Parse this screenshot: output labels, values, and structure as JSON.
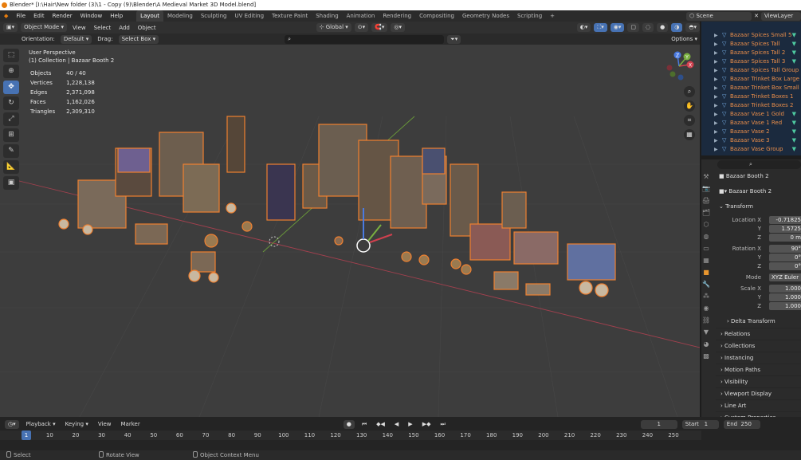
{
  "title": "Blender* [I:\\Hair\\New folder (3)\\1 - Copy (9)\\Blender\\A Medieval Market 3D Model.blend]",
  "menu": [
    "File",
    "Edit",
    "Render",
    "Window",
    "Help"
  ],
  "workspaces": [
    "Layout",
    "Modeling",
    "Sculpting",
    "UV Editing",
    "Texture Paint",
    "Shading",
    "Animation",
    "Rendering",
    "Compositing",
    "Geometry Nodes",
    "Scripting",
    "+"
  ],
  "active_workspace": "Layout",
  "scene": "Scene",
  "view_layer": "ViewLayer",
  "viewport_header": {
    "mode": "Object Mode",
    "menus": [
      "View",
      "Select",
      "Add",
      "Object"
    ],
    "transform": "Global",
    "options": "Options"
  },
  "tool_settings": {
    "orientation_label": "Orientation:",
    "orientation": "Default",
    "drag_label": "Drag:",
    "drag": "Select Box"
  },
  "overlay_text": {
    "view": "User Perspective",
    "collection": "(1) Collection | Bazaar Booth 2"
  },
  "stats": [
    {
      "label": "Objects",
      "value": "40 / 40"
    },
    {
      "label": "Vertices",
      "value": "1,228,138"
    },
    {
      "label": "Edges",
      "value": "2,371,098"
    },
    {
      "label": "Faces",
      "value": "1,162,026"
    },
    {
      "label": "Triangles",
      "value": "2,309,310"
    }
  ],
  "gizmo": {
    "x": "X",
    "y": "Y",
    "z": "Z"
  },
  "outliner": [
    "Bazaar Spices Small 5",
    "Bazaar Spices Tall",
    "Bazaar Spices Tall 2",
    "Bazaar Spices Tall 3",
    "Bazaar Spices Tall Group",
    "Bazaar Trinket Box Large",
    "Bazaar Trinket Box Small",
    "Bazaar Trinket Boxes 1",
    "Bazaar Trinket Boxes 2",
    "Bazaar Vase 1 Gold",
    "Bazaar Vase 1 Red",
    "Bazaar Vase 2",
    "Bazaar Vase 3",
    "Bazaar Vase Group"
  ],
  "properties": {
    "object_name": "Bazaar Booth 2",
    "object_name_field": "Bazaar Booth 2",
    "transform_title": "Transform",
    "location_label": "Location X",
    "loc_x": "-0.71825",
    "loc_y": "1.5725",
    "loc_z": "0 m",
    "rotation_label": "Rotation X",
    "rot_x": "90°",
    "rot_y": "0°",
    "rot_z": "0°",
    "mode_label": "Mode",
    "mode": "XYZ Euler",
    "scale_label": "Scale X",
    "scale_x": "1.000",
    "scale_y": "1.000",
    "scale_z": "1.000",
    "axis_y": "Y",
    "axis_z": "Z",
    "delta": "Delta Transform",
    "panels": [
      "Relations",
      "Collections",
      "Instancing",
      "Motion Paths",
      "Visibility",
      "Viewport Display",
      "Line Art",
      "Custom Properties"
    ]
  },
  "timeline": {
    "menus": [
      "Playback",
      "Keying",
      "View",
      "Marker"
    ],
    "current_frame": "1",
    "start_label": "Start",
    "start": "1",
    "end_label": "End",
    "end": "250",
    "ticks": [
      "1",
      "10",
      "20",
      "30",
      "40",
      "50",
      "60",
      "70",
      "80",
      "90",
      "100",
      "110",
      "120",
      "130",
      "140",
      "150",
      "160",
      "170",
      "180",
      "190",
      "200",
      "210",
      "220",
      "230",
      "240",
      "250"
    ]
  },
  "status": {
    "select": "Select",
    "rotate": "Rotate View",
    "context": "Object Context Menu"
  },
  "colors": {
    "accent": "#4772b3",
    "selection": "#e8731a",
    "active_tab": "#e8962f"
  }
}
